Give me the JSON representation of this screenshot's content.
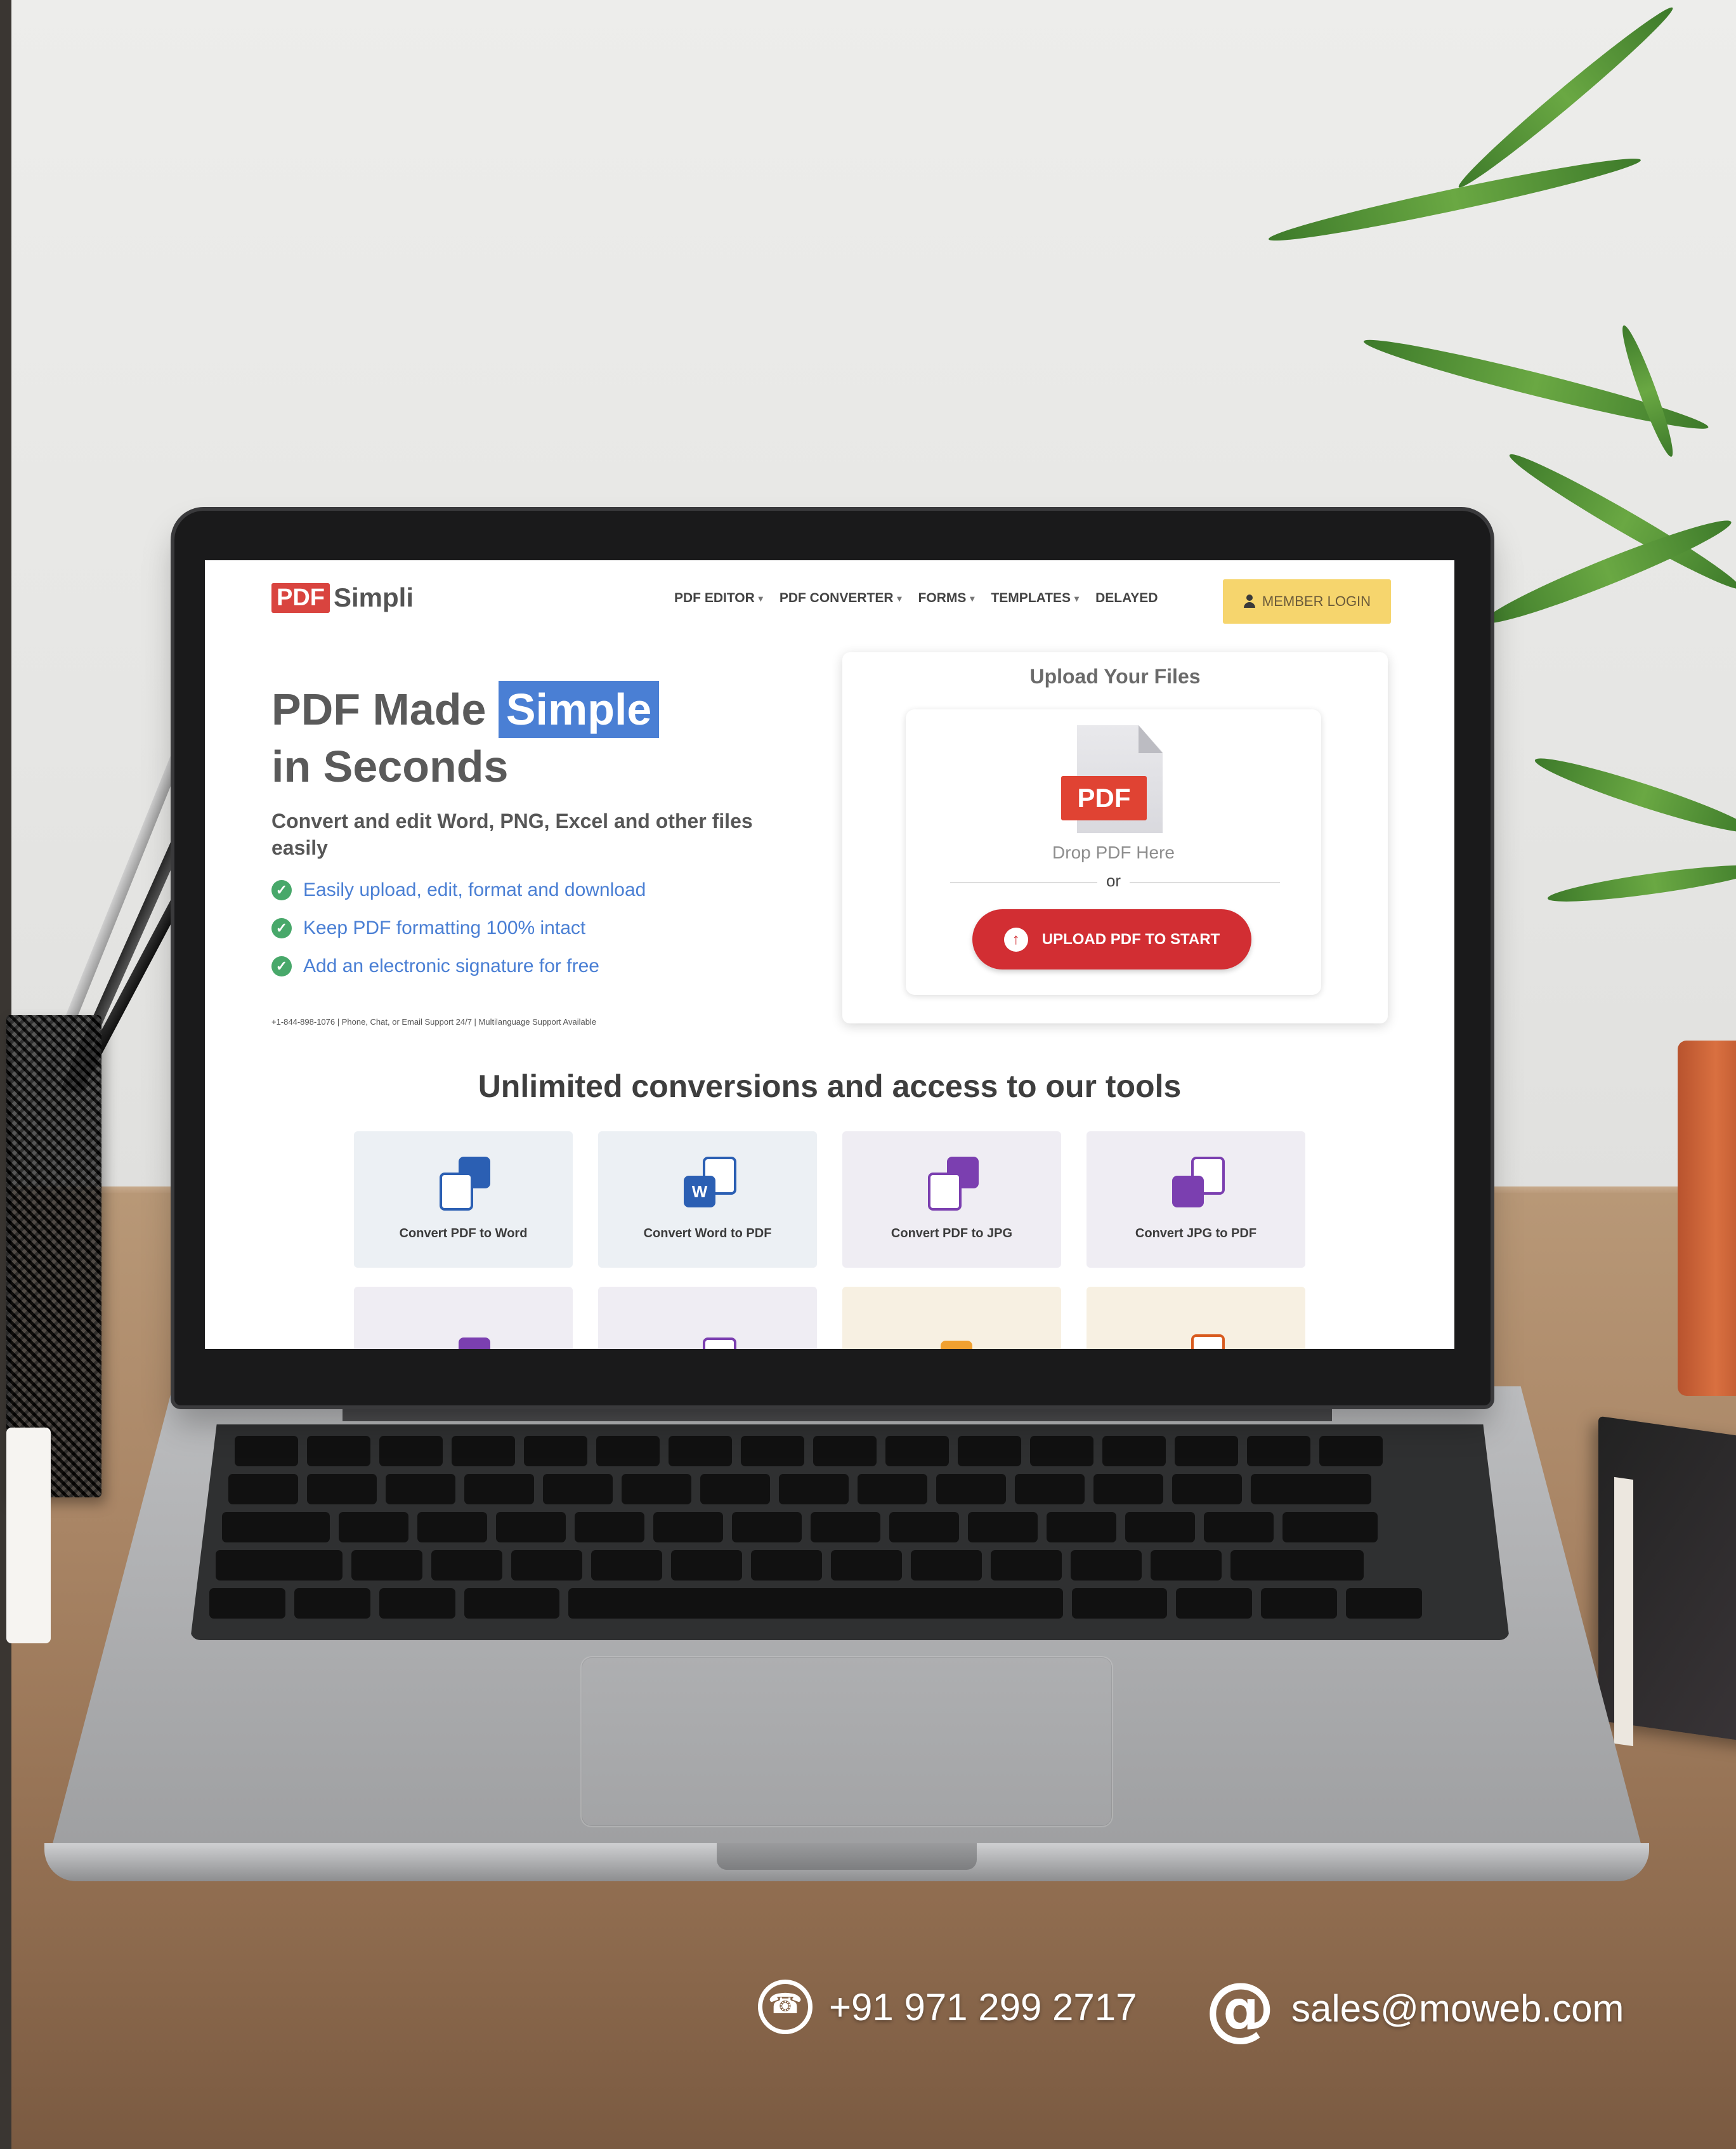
{
  "nav": {
    "logo_badge": "PDF",
    "logo_text": "Simpli",
    "menu": [
      {
        "label": "PDF EDITOR",
        "dropdown": true
      },
      {
        "label": "PDF CONVERTER",
        "dropdown": true
      },
      {
        "label": "FORMS",
        "dropdown": true
      },
      {
        "label": "TEMPLATES",
        "dropdown": true
      },
      {
        "label": "DELAYED",
        "dropdown": false
      }
    ],
    "member_login": "MEMBER LOGIN"
  },
  "hero": {
    "title_part1": "PDF Made",
    "title_highlight": "Simple",
    "title_part2": "in Seconds",
    "subtitle": "Convert and edit Word, PNG, Excel and other files easily",
    "bullets": [
      "Easily upload, edit, format and download",
      "Keep PDF formatting 100% intact",
      "Add an electronic signature for free"
    ],
    "support": "+1-844-898-1076 | Phone, Chat, or Email Support 24/7 | Multilanguage Support Available"
  },
  "upload": {
    "title": "Upload Your Files",
    "badge": "PDF",
    "drop_text": "Drop PDF Here",
    "or": "or",
    "button": "UPLOAD PDF TO START"
  },
  "tools": {
    "title": "Unlimited conversions and access to our tools",
    "items": [
      {
        "label": "Convert PDF to Word",
        "icon": "pdf-to-word-icon"
      },
      {
        "label": "Convert Word to PDF",
        "icon": "word-to-pdf-icon"
      },
      {
        "label": "Convert PDF to JPG",
        "icon": "pdf-to-jpg-icon"
      },
      {
        "label": "Convert JPG to PDF",
        "icon": "jpg-to-pdf-icon"
      }
    ]
  },
  "contact": {
    "phone": "+91 971 299 2717",
    "email": "sales@moweb.com"
  },
  "colors": {
    "brand_red": "#d9443f",
    "highlight_blue": "#4a7fd4",
    "member_yellow": "#f6d56d",
    "upload_button": "#d22e33",
    "check_green": "#48a86a"
  }
}
